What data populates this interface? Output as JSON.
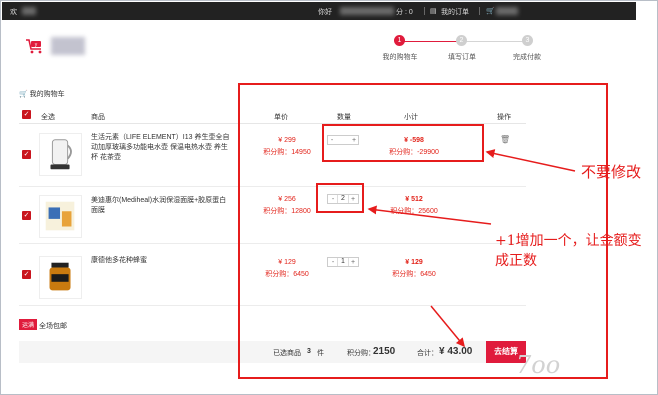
{
  "topbar": {
    "welcome": "欢",
    "greeting": "你好 ",
    "points_short": "分 : 0",
    "my_orders": "我的订单",
    "cart_icon": "cart-icon"
  },
  "steps": [
    {
      "num": "1",
      "label": "我的购物车"
    },
    {
      "num": "2",
      "label": "填写订单"
    },
    {
      "num": "3",
      "label": "完成付款"
    }
  ],
  "section_title": "我的购物车",
  "table": {
    "select_all": "全选",
    "product": "商品",
    "unit_price": "单价",
    "quantity": "数量",
    "subtotal": "小计",
    "action": "操作"
  },
  "items": [
    {
      "name": "生活元素（LIFE ELEMENT）I13 养生壶全自动加厚玻璃多功能电水壶 保温电热水壶 养生杯 花茶壶",
      "price": "¥ 299",
      "points": "积分购：14950",
      "qty": "",
      "subtotal": "¥ -598",
      "subtotal_points": "积分购：-29900"
    },
    {
      "name": "美迪惠尔(Mediheal)水润保湿面膜+胶原蛋白面膜",
      "price": "¥ 256",
      "points": "积分购：12800",
      "qty": "2",
      "subtotal": "¥ 512",
      "subtotal_points": "积分购：25600"
    },
    {
      "name": "康德他多花种蜂蜜",
      "price": "¥ 129",
      "points": "积分购：6450",
      "qty": "1",
      "subtotal": "¥ 129",
      "subtotal_points": "积分购：6450"
    }
  ],
  "shipping": {
    "tag": "运满",
    "text": "全场包邮"
  },
  "footer": {
    "selected_label": "已选商品",
    "selected_count": "3",
    "selected_unit": "件",
    "points_label": "积分购：",
    "points_value": "2150",
    "total_label": "合计：",
    "total_value": "¥ 43.00",
    "checkout": "去结算"
  },
  "annotations": {
    "no_change": "不要修改",
    "explain": "+1增加一个，让金额变成正数"
  },
  "colors": {
    "accent": "#e01b3c",
    "annotation": "#e61c1c"
  }
}
